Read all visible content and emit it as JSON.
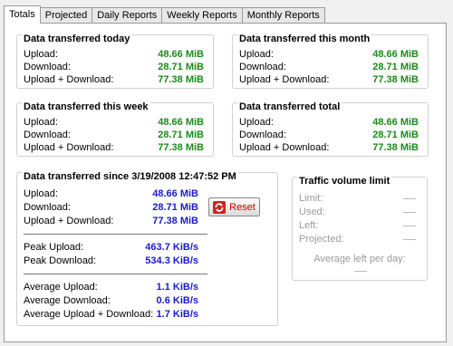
{
  "tabs": [
    {
      "label": "Totals",
      "active": true
    },
    {
      "label": "Projected"
    },
    {
      "label": "Daily Reports"
    },
    {
      "label": "Weekly Reports"
    },
    {
      "label": "Monthly Reports"
    }
  ],
  "today": {
    "title": "Data transferred today",
    "rows": [
      {
        "label": "Upload:",
        "value": "48.66 MiB"
      },
      {
        "label": "Download:",
        "value": "28.71 MiB"
      },
      {
        "label": "Upload + Download:",
        "value": "77.38 MiB"
      }
    ]
  },
  "month": {
    "title": "Data transferred this month",
    "rows": [
      {
        "label": "Upload:",
        "value": "48.66 MiB"
      },
      {
        "label": "Download:",
        "value": "28.71 MiB"
      },
      {
        "label": "Upload + Download:",
        "value": "77.38 MiB"
      }
    ]
  },
  "week": {
    "title": "Data transferred this week",
    "rows": [
      {
        "label": "Upload:",
        "value": "48.66 MiB"
      },
      {
        "label": "Download:",
        "value": "28.71 MiB"
      },
      {
        "label": "Upload + Download:",
        "value": "77.38 MiB"
      }
    ]
  },
  "total": {
    "title": "Data transferred total",
    "rows": [
      {
        "label": "Upload:",
        "value": "48.66 MiB"
      },
      {
        "label": "Download:",
        "value": "28.71 MiB"
      },
      {
        "label": "Upload + Download:",
        "value": "77.38 MiB"
      }
    ]
  },
  "since": {
    "title": "Data transferred since 3/19/2008 12:47:52 PM",
    "rows": [
      {
        "label": "Upload:",
        "value": "48.66 MiB"
      },
      {
        "label": "Download:",
        "value": "28.71 MiB"
      },
      {
        "label": "Upload + Download:",
        "value": "77.38 MiB"
      }
    ],
    "peak": [
      {
        "label": "Peak Upload:",
        "value": "463.7 KiB/s"
      },
      {
        "label": "Peak Download:",
        "value": "534.3 KiB/s"
      }
    ],
    "average": [
      {
        "label": "Average Upload:",
        "value": "1.1 KiB/s"
      },
      {
        "label": "Average Download:",
        "value": "0.6 KiB/s"
      },
      {
        "label": "Average Upload + Download:",
        "value": "1.7 KiB/s"
      }
    ],
    "reset_label": "Reset"
  },
  "limit": {
    "title": "Traffic volume limit",
    "rows": [
      {
        "label": "Limit:"
      },
      {
        "label": "Used:"
      },
      {
        "label": "Left:"
      },
      {
        "label": "Projected:"
      }
    ],
    "avg_label": "Average left per day:"
  },
  "icons": {
    "reset": "refresh-arrows-icon"
  },
  "colors": {
    "green_value": "#1a8a1a",
    "blue_value": "#1a1acc",
    "reset_text": "#cc0000"
  }
}
